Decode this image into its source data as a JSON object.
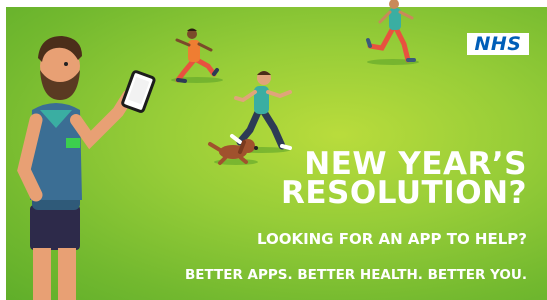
{
  "banner": {
    "logo_text": "NHS",
    "headline_line1": "NEW YEAR’S",
    "headline_line2": "RESOLUTION?",
    "subheadline": "LOOKING FOR AN APP TO HELP?",
    "tagline": "BETTER APPS. BETTER HEALTH. BETTER YOU."
  },
  "colors": {
    "background": "#8cc63f",
    "logo_blue": "#005eb8",
    "text": "#ffffff"
  }
}
